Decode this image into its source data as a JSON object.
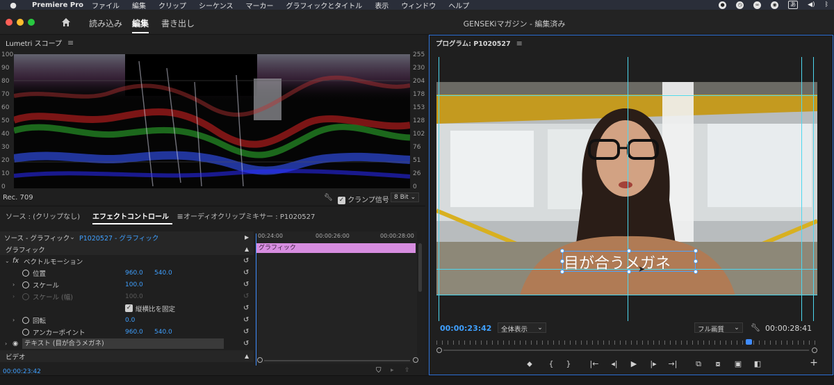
{
  "menubar": {
    "app_name": "Premiere Pro",
    "items": [
      "ファイル",
      "編集",
      "クリップ",
      "シーケンス",
      "マーカー",
      "グラフィックとタイトル",
      "表示",
      "ウィンドウ",
      "ヘルプ"
    ],
    "status_icons": [
      "record-icon",
      "clock-icon",
      "cc-icon",
      "cd-icon",
      "あ",
      "volume-icon",
      "bluetooth-icon"
    ],
    "ime_label": "あ"
  },
  "titlebar": {
    "workspaces": [
      "読み込み",
      "編集",
      "書き出し"
    ],
    "active_workspace": "編集",
    "document_title": "GENSEKiマガジン - 編集済み"
  },
  "lumetri": {
    "title": "Lumetri スコープ",
    "left_scale": [
      "100",
      "90",
      "80",
      "70",
      "60",
      "50",
      "40",
      "30",
      "20",
      "10",
      "0"
    ],
    "right_scale": [
      "255",
      "230",
      "204",
      "178",
      "153",
      "128",
      "102",
      "76",
      "51",
      "26",
      "0"
    ],
    "color_space": "Rec. 709",
    "clamp_label": "クランプ信号",
    "clamp_checked": true,
    "bit_depth": "8 Bit"
  },
  "effect_controls": {
    "tabs": [
      "ソース : (クリップなし)",
      "エフェクトコントロール",
      "オーディオクリップミキサー : P1020527"
    ],
    "active_tab": "エフェクトコントロール",
    "source_label": "ソース - グラフィック",
    "sequence_label": "P1020527 - グラフィック",
    "section_graphic": "グラフィック",
    "vector_motion": "ベクトルモーション",
    "props": {
      "position": {
        "label": "位置",
        "x": "960.0",
        "y": "540.0"
      },
      "scale": {
        "label": "スケール",
        "value": "100.0"
      },
      "scale_width": {
        "label": "スケール (幅)",
        "value": "100.0"
      },
      "uniform_scale": {
        "label": "縦横比を固定",
        "checked": true
      },
      "rotation": {
        "label": "回転",
        "value": "0.0"
      },
      "anchor": {
        "label": "アンカーポイント",
        "x": "960.0",
        "y": "540.0"
      }
    },
    "text_layer": "テキスト (目が合うメガネ)",
    "section_video": "ビデオ",
    "current_time": "00:00:23:42",
    "timeline_ticks": [
      "00:24:00",
      "00:00:26:00",
      "00:00:28:00"
    ],
    "clip_name": "グラフィック"
  },
  "program": {
    "title": "プログラム: P1020527",
    "caption": "目が合うメガネ",
    "current_time": "00:00:23:42",
    "zoom": "全体表示",
    "quality": "フル画質",
    "duration": "00:00:28:41",
    "controls": [
      "marker-icon",
      "in-point-icon",
      "out-point-icon",
      "go-to-in-icon",
      "step-back-icon",
      "play-icon",
      "step-forward-icon",
      "go-to-out-icon",
      "insert-icon",
      "overwrite-icon",
      "export-frame-icon",
      "compare-icon",
      "add-button-icon"
    ],
    "control_glyphs": [
      "⬥",
      "{",
      "}",
      "|←",
      "◂|",
      "▶",
      "|▸",
      "→|",
      "⧉",
      "⧇",
      "▣",
      "◧",
      "+"
    ]
  },
  "colors": {
    "accent_blue": "#3fa0ff",
    "guide_cyan": "#4dd8f0",
    "clip_pink": "#d78de0",
    "monitor_border": "#2f72d8"
  }
}
